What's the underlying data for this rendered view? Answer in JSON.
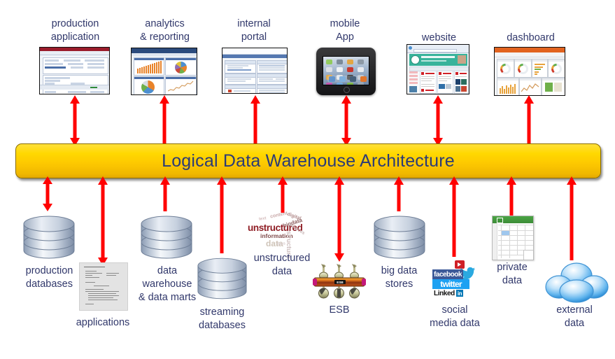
{
  "banner": {
    "label": "Logical Data Warehouse Architecture",
    "fill_top": "#ffe03a",
    "fill_bottom": "#e3a800",
    "text_color": "#2b3b77"
  },
  "theme": {
    "arrow_color": "#ff0000",
    "caption_color": "#31386b",
    "background": "#ffffff"
  },
  "consumers": [
    {
      "id": "production-application",
      "label": "production\napplication",
      "icon": "app-window-screenshot",
      "arrow": "double"
    },
    {
      "id": "analytics-reporting",
      "label": "analytics\n& reporting",
      "icon": "bi-dashboard-screenshot",
      "arrow": "up"
    },
    {
      "id": "internal-portal",
      "label": "internal\nportal",
      "icon": "portal-screenshot",
      "arrow": "up"
    },
    {
      "id": "mobile-app",
      "label": "mobile\nApp",
      "icon": "tablet-device",
      "arrow": "double"
    },
    {
      "id": "website",
      "label": "website",
      "icon": "browser-screenshot",
      "arrow": "double"
    },
    {
      "id": "dashboard",
      "label": "dashboard",
      "icon": "kpi-dashboard-screenshot",
      "arrow": "up"
    }
  ],
  "sources": [
    {
      "id": "production-databases",
      "label": "production\ndatabases",
      "icon": "database-cylinder-icon",
      "arrow": "double"
    },
    {
      "id": "applications",
      "label": "applications",
      "icon": "document-icon",
      "arrow": "double"
    },
    {
      "id": "data-warehouse-data-marts",
      "label": "data\nwarehouse\n& data marts",
      "icon": "database-cylinder-icon",
      "arrow": "up"
    },
    {
      "id": "streaming-databases",
      "label": "streaming\ndatabases",
      "icon": "database-cylinder-icon",
      "arrow": "up"
    },
    {
      "id": "unstructured-data",
      "label": "unstructured\ndata",
      "icon": "word-cloud-icon",
      "arrow": "up"
    },
    {
      "id": "esb",
      "label": "ESB",
      "icon": "esb-bus-icon",
      "arrow": "double"
    },
    {
      "id": "big-data-stores",
      "label": "big data\nstores",
      "icon": "database-cylinder-icon",
      "arrow": "up"
    },
    {
      "id": "social-media-data",
      "label": "social\nmedia data",
      "icon": "social-network-logos-icon",
      "arrow": "up"
    },
    {
      "id": "private-data",
      "label": "private\ndata",
      "icon": "spreadsheet-icon",
      "arrow": "up"
    },
    {
      "id": "external-data",
      "label": "external\ndata",
      "icon": "cloud-icon",
      "arrow": "up"
    }
  ],
  "word_cloud": {
    "words": [
      "unstructured",
      "information",
      "data",
      "structure",
      "digital",
      "text",
      "content"
    ]
  },
  "esb_icon": {
    "label": "ESB"
  },
  "social_logos": {
    "facebook": "facebook",
    "twitter": "twitter",
    "linkedin": "Linked",
    "linkedin_badge": "in"
  }
}
